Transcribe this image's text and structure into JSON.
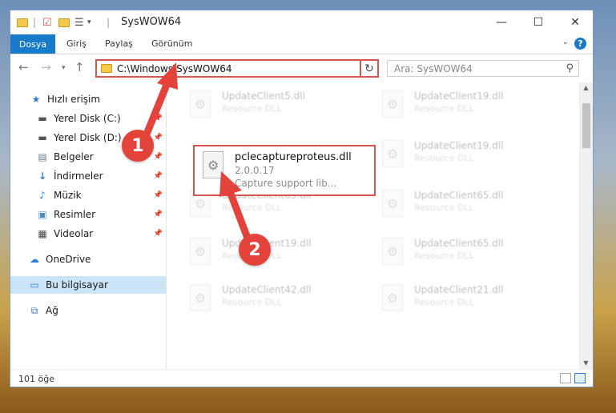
{
  "window": {
    "title": "SysWOW64",
    "controls": {
      "minimize": "—",
      "maximize": "☐",
      "close": "✕"
    }
  },
  "ribbon": {
    "tabs": [
      "Dosya",
      "Giriş",
      "Paylaş",
      "Görünüm"
    ],
    "help": "?"
  },
  "nav": {
    "address": "C:\\Windows\\SysWOW64",
    "search_placeholder": "Ara: SysWOW64"
  },
  "sidebar": {
    "items": [
      {
        "label": "Hızlı erişim",
        "icon": "star-icon"
      },
      {
        "label": "Yerel Disk (C:)",
        "icon": "drive-icon",
        "pinned": true
      },
      {
        "label": "Yerel Disk (D:)",
        "icon": "drive-icon",
        "pinned": true
      },
      {
        "label": "Belgeler",
        "icon": "documents-icon",
        "pinned": true
      },
      {
        "label": "İndirmeler",
        "icon": "download-icon",
        "pinned": true
      },
      {
        "label": "Müzik",
        "icon": "music-icon",
        "pinned": true
      },
      {
        "label": "Resimler",
        "icon": "pictures-icon",
        "pinned": true
      },
      {
        "label": "Videolar",
        "icon": "video-icon",
        "pinned": true
      },
      {
        "label": "OneDrive",
        "icon": "cloud-icon"
      },
      {
        "label": "Bu bilgisayar",
        "icon": "computer-icon",
        "selected": true
      },
      {
        "label": "Ağ",
        "icon": "network-icon"
      }
    ]
  },
  "files": {
    "highlighted": {
      "name": "pclecaptureproteus.dll",
      "version": "2.0.0.17",
      "description": "Capture support lib..."
    },
    "background": [
      {
        "name": "UpdateClient5.dll",
        "sub": "Resource DLL"
      },
      {
        "name": "UpdateClient19.dll",
        "sub": "Resource DLL"
      },
      {
        "name": "UpdateClient19.dll",
        "sub": "Resource DLL"
      },
      {
        "name": "UpdateClient65.dll",
        "sub": "Resource DLL"
      },
      {
        "name": "UpdateClient65.dll",
        "sub": "Resource DLL"
      },
      {
        "name": "UpdateClient19.dll",
        "sub": "Resource DLL"
      },
      {
        "name": "UpdateClient65.dll",
        "sub": "Resource DLL"
      },
      {
        "name": "UpdateClient42.dll",
        "sub": "Resource DLL"
      },
      {
        "name": "UpdateClient21.dll",
        "sub": "Resource DLL"
      }
    ]
  },
  "status": {
    "count": "101 öğe"
  },
  "annotations": {
    "step1": "1",
    "step2": "2",
    "color": "#e4433c"
  }
}
